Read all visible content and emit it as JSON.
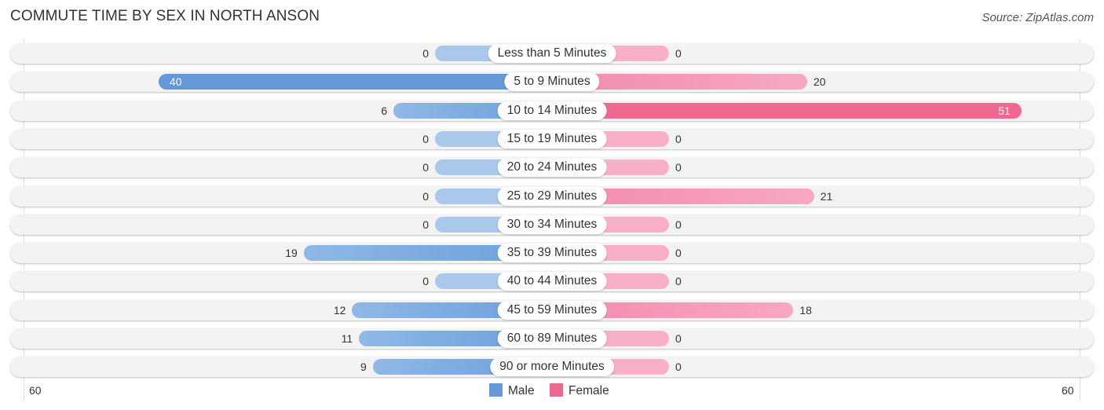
{
  "title": "COMMUTE TIME BY SEX IN NORTH ANSON",
  "source": "Source: ZipAtlas.com",
  "colors": {
    "male": "#6399d8",
    "female": "#f06790"
  },
  "chart_data": {
    "type": "bar",
    "orientation": "horizontal-diverging",
    "title": "COMMUTE TIME BY SEX IN NORTH ANSON",
    "categories": [
      "Less than 5 Minutes",
      "5 to 9 Minutes",
      "10 to 14 Minutes",
      "15 to 19 Minutes",
      "20 to 24 Minutes",
      "25 to 29 Minutes",
      "30 to 34 Minutes",
      "35 to 39 Minutes",
      "40 to 44 Minutes",
      "45 to 59 Minutes",
      "60 to 89 Minutes",
      "90 or more Minutes"
    ],
    "series": [
      {
        "name": "Male",
        "values": [
          0,
          40,
          6,
          0,
          0,
          0,
          0,
          19,
          0,
          12,
          11,
          9
        ]
      },
      {
        "name": "Female",
        "values": [
          0,
          20,
          51,
          0,
          0,
          21,
          0,
          0,
          0,
          18,
          0,
          0
        ]
      }
    ],
    "axis": {
      "left_label": "60",
      "right_label": "60",
      "range": [
        -60,
        60
      ]
    },
    "legend": {
      "position": "bottom-center",
      "entries": [
        "Male",
        "Female"
      ]
    },
    "grid": false
  }
}
